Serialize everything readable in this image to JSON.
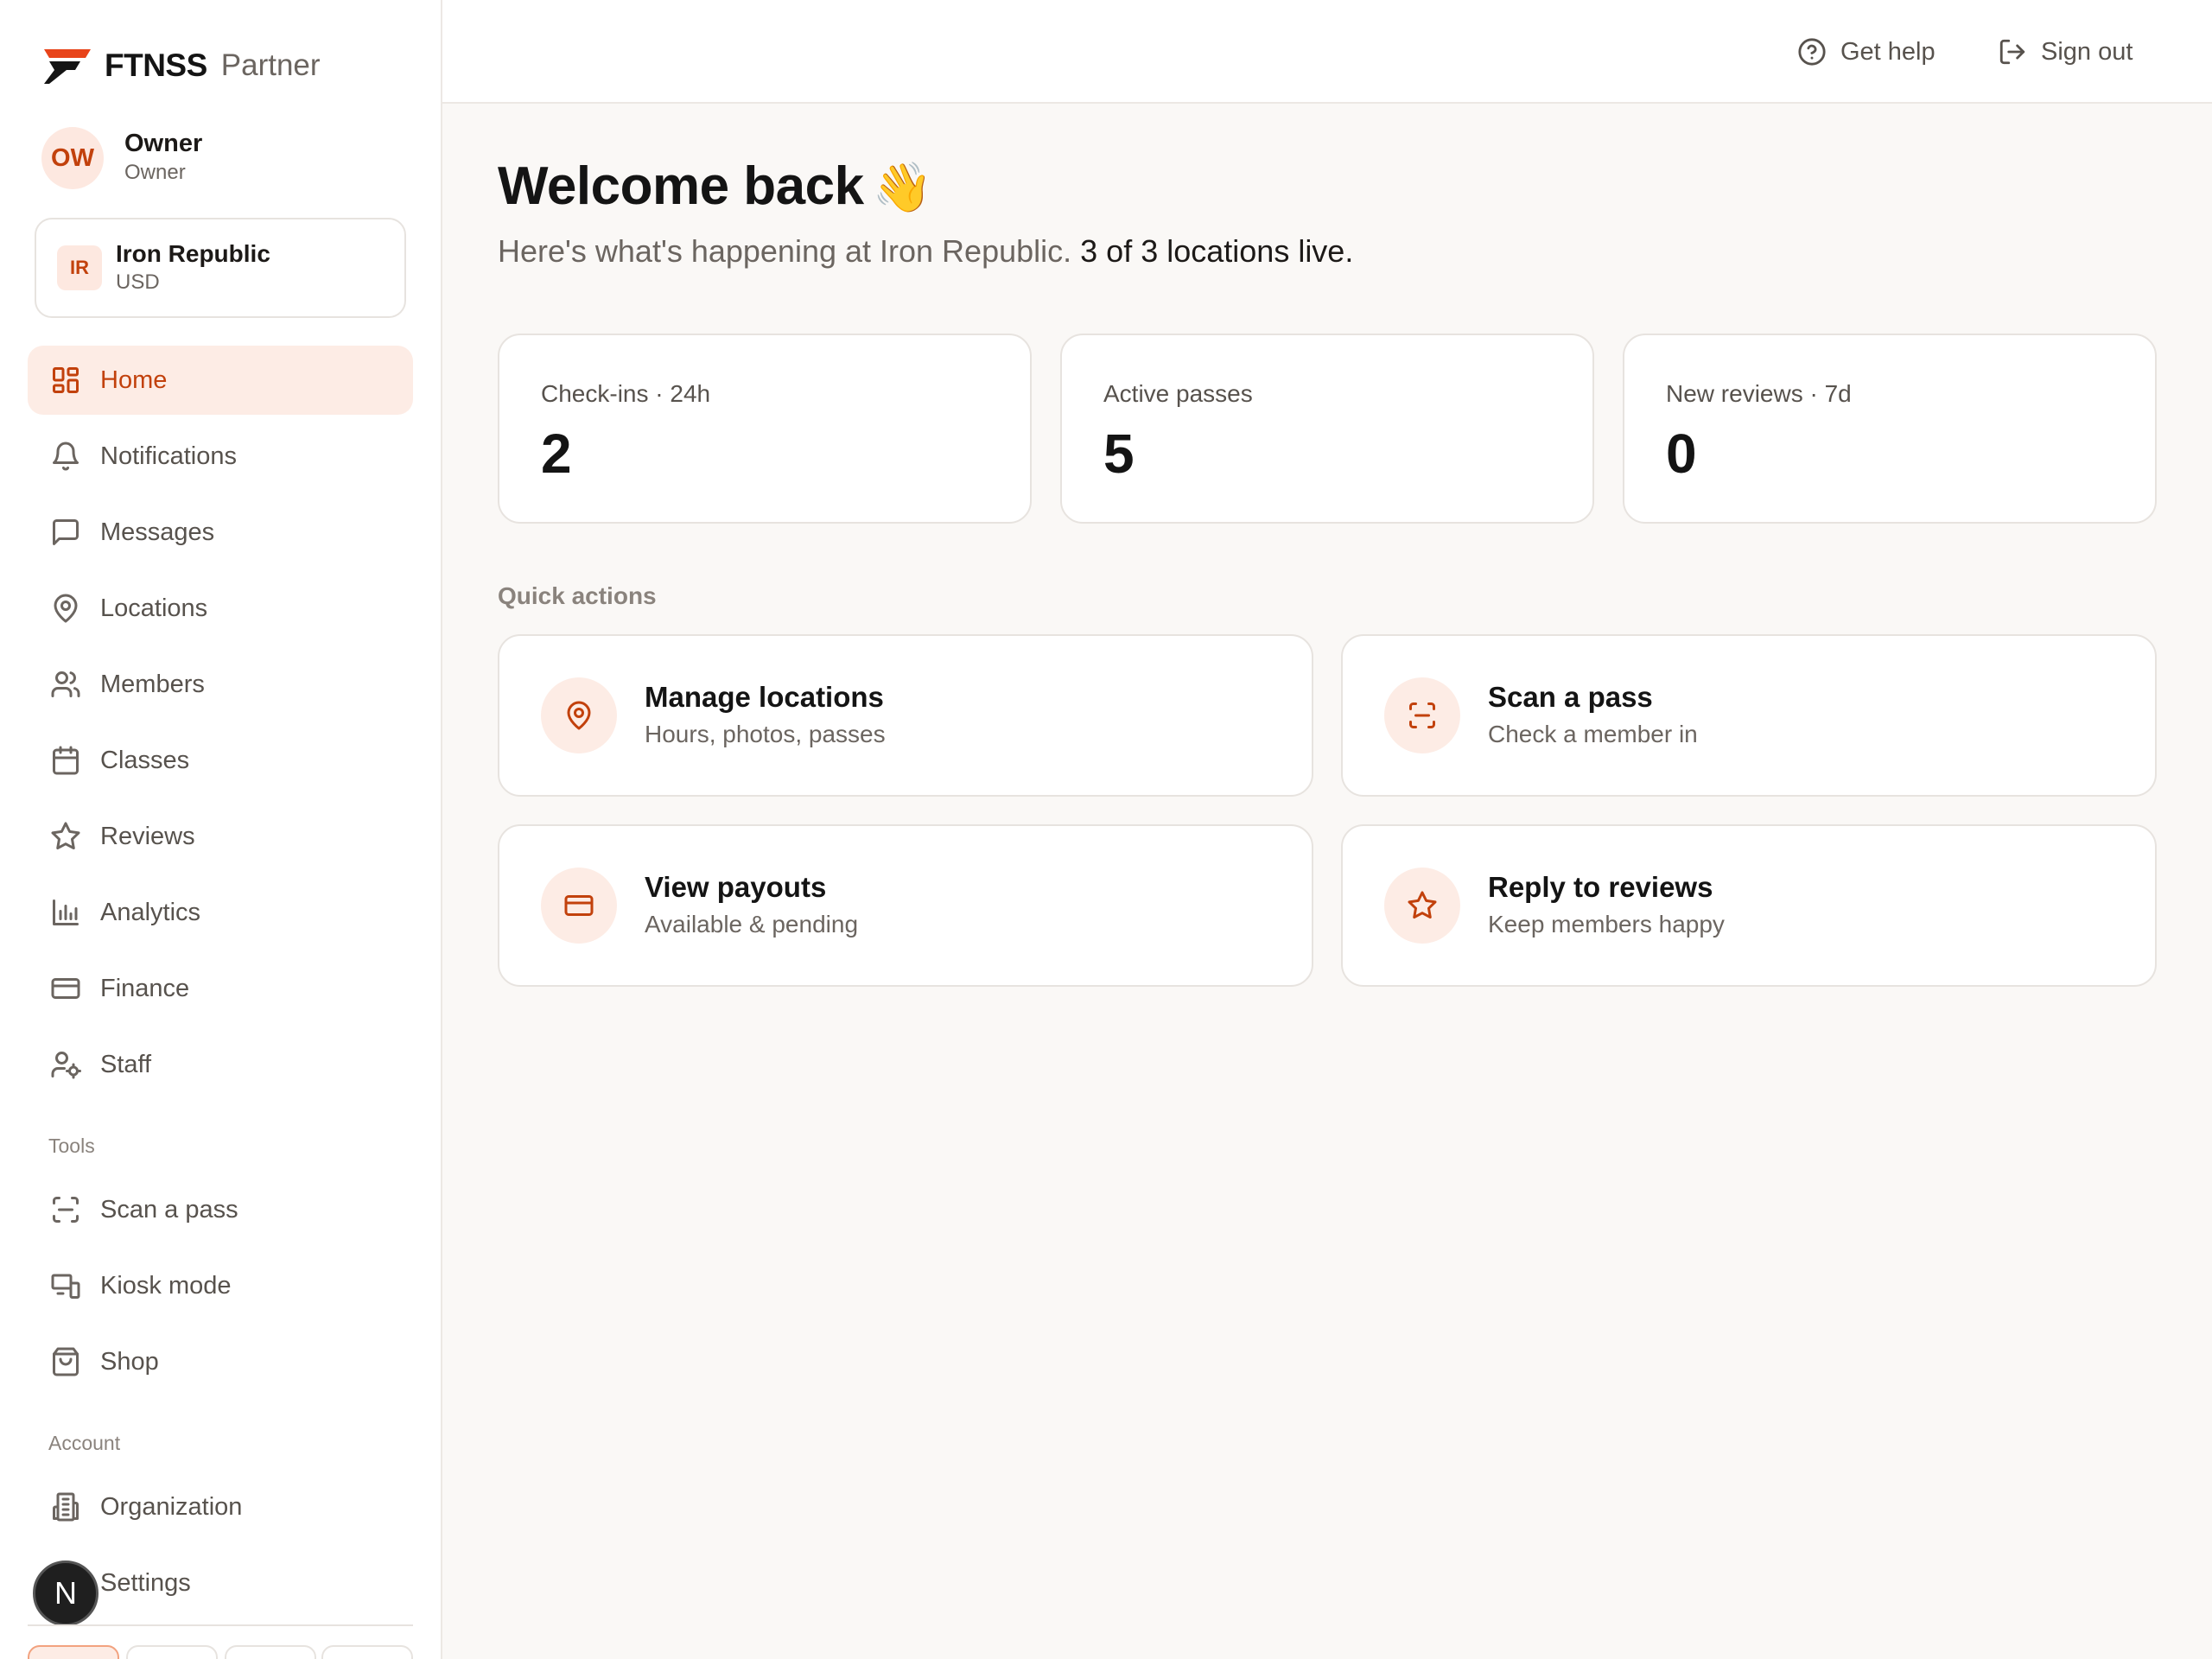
{
  "brand": {
    "name": "FTNSS",
    "sub": "Partner"
  },
  "user": {
    "initials": "OW",
    "name": "Owner",
    "role": "Owner"
  },
  "org": {
    "initials": "IR",
    "name": "Iron Republic",
    "currency": "USD"
  },
  "nav": {
    "main": [
      {
        "label": "Home",
        "icon": "grid-icon"
      },
      {
        "label": "Notifications",
        "icon": "bell-icon"
      },
      {
        "label": "Messages",
        "icon": "message-icon"
      },
      {
        "label": "Locations",
        "icon": "map-pin-icon"
      },
      {
        "label": "Members",
        "icon": "users-icon"
      },
      {
        "label": "Classes",
        "icon": "calendar-icon"
      },
      {
        "label": "Reviews",
        "icon": "star-icon"
      },
      {
        "label": "Analytics",
        "icon": "bar-chart-icon"
      },
      {
        "label": "Finance",
        "icon": "credit-card-icon"
      },
      {
        "label": "Staff",
        "icon": "user-gear-icon"
      }
    ],
    "tools_label": "Tools",
    "tools": [
      {
        "label": "Scan a pass",
        "icon": "scan-icon"
      },
      {
        "label": "Kiosk mode",
        "icon": "kiosk-icon"
      },
      {
        "label": "Shop",
        "icon": "shopping-bag-icon"
      }
    ],
    "account_label": "Account",
    "account": [
      {
        "label": "Organization",
        "icon": "building-icon"
      },
      {
        "label": "Settings",
        "icon": "settings-icon"
      }
    ]
  },
  "dev_badge": "N",
  "topbar": {
    "help": "Get help",
    "signout": "Sign out"
  },
  "main": {
    "welcome": "Welcome back",
    "wave": "👋",
    "sub_lead": "Here's what's happening at Iron Republic.",
    "sub_strong": "3 of 3 locations live.",
    "stats": [
      {
        "label": "Check-ins · 24h",
        "value": "2"
      },
      {
        "label": "Active passes",
        "value": "5"
      },
      {
        "label": "New reviews · 7d",
        "value": "0"
      }
    ],
    "quick_actions_label": "Quick actions",
    "quick_actions": [
      {
        "title": "Manage locations",
        "desc": "Hours, photos, passes",
        "icon": "map-pin-icon"
      },
      {
        "title": "Scan a pass",
        "desc": "Check a member in",
        "icon": "scan-icon"
      },
      {
        "title": "View payouts",
        "desc": "Available & pending",
        "icon": "credit-card-icon"
      },
      {
        "title": "Reply to reviews",
        "desc": "Keep members happy",
        "icon": "star-icon"
      }
    ]
  },
  "colors": {
    "accent": "#c2410c",
    "accent_bg": "#fdece5",
    "page_bg": "#faf8f6"
  }
}
